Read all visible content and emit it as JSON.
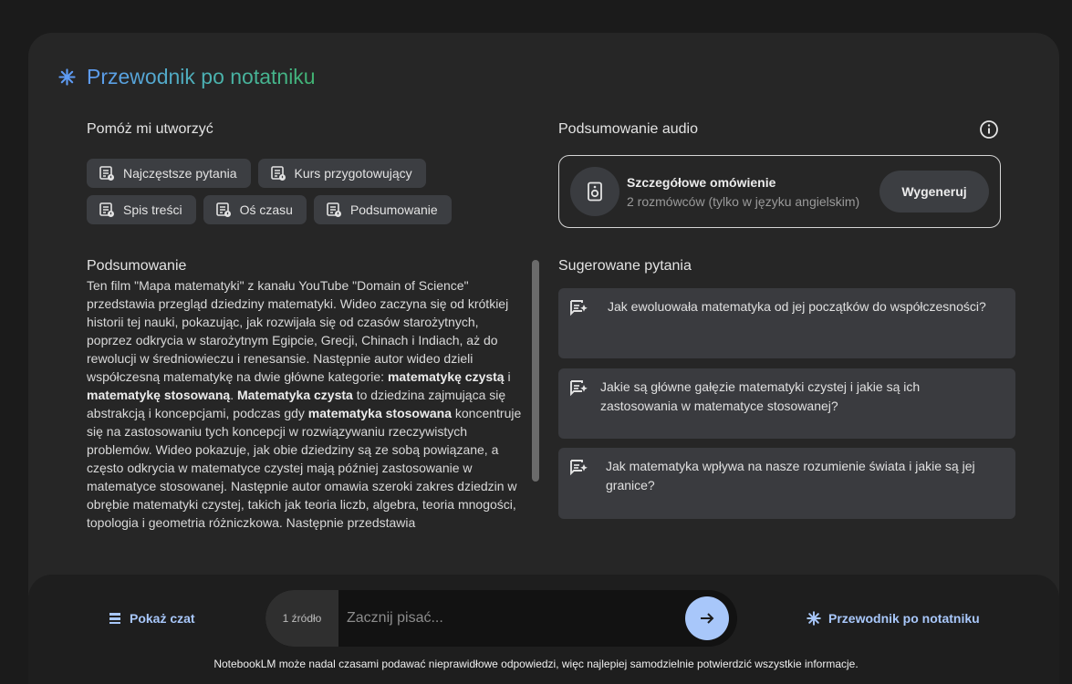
{
  "guide": {
    "title": "Przewodnik po notatniku",
    "icon": "spark-icon"
  },
  "help_create": {
    "label": "Pomóż mi utworzyć",
    "chips": [
      {
        "label": "Najczęstsze pytania",
        "icon": "note-icon"
      },
      {
        "label": "Kurs przygotowujący",
        "icon": "note-icon"
      },
      {
        "label": "Spis treści",
        "icon": "note-icon"
      },
      {
        "label": "Oś czasu",
        "icon": "note-icon"
      },
      {
        "label": "Podsumowanie",
        "icon": "note-icon"
      }
    ]
  },
  "summary": {
    "title": "Podsumowanie",
    "segments": [
      {
        "text": "Ten film \"Mapa matematyki\" z kanału YouTube \"Domain of Science\" przedstawia przegląd dziedziny matematyki. Wideo zaczyna się od krótkiej historii tej nauki, pokazując, jak rozwijała się od czasów starożytnych, poprzez odkrycia w starożytnym Egipcie, Grecji, Chinach i Indiach, aż do rewolucji w średniowieczu i renesansie. Następnie autor wideo dzieli współczesną matematykę na dwie główne kategorie: ",
        "bold": false
      },
      {
        "text": "matematykę czystą",
        "bold": true
      },
      {
        "text": " i ",
        "bold": false
      },
      {
        "text": "matematykę stosowaną",
        "bold": true
      },
      {
        "text": ". ",
        "bold": false
      },
      {
        "text": "Matematyka czysta",
        "bold": true
      },
      {
        "text": " to dziedzina zajmująca się abstrakcją i koncepcjami, podczas gdy ",
        "bold": false
      },
      {
        "text": "matematyka stosowana",
        "bold": true
      },
      {
        "text": " koncentruje się na zastosowaniu tych koncepcji w rozwiązywaniu rzeczywistych problemów. Wideo pokazuje, jak obie dziedziny są ze sobą powiązane, a często odkrycia w matematyce czystej mają później zastosowanie w matematyce stosowanej. Następnie autor omawia szeroki zakres dziedzin w obrębie matematyki czystej, takich jak teoria liczb, algebra, teoria mnogości, topologia i geometria różniczkowa. Następnie przedstawia",
        "bold": false
      }
    ]
  },
  "audio": {
    "label": "Podsumowanie audio",
    "info_icon": "info-icon",
    "card_title": "Szczegółowe omówienie",
    "card_subtitle": "2 rozmówców (tylko w języku angielskim)",
    "button": "Wygeneruj",
    "icon": "speaker-icon"
  },
  "suggested": {
    "label": "Sugerowane pytania",
    "questions": [
      {
        "text": "Jak ewoluowała matematyka od jej początków do współczesności?"
      },
      {
        "text": "Jakie są główne gałęzie matematyki czystej i jakie są ich zastosowania w matematyce stosowanej?"
      },
      {
        "text": "Jak matematyka wpływa na nasze rozumienie świata i jakie są jej granice?"
      }
    ]
  },
  "footer": {
    "show_chat": "Pokaż czat",
    "source_count": "1 źródło",
    "input_placeholder": "Zacznij pisać...",
    "guide_link": "Przewodnik po notatniku",
    "disclaimer": "NotebookLM może nadal czasami podawać nieprawidłowe odpowiedzi, więc najlepiej samodzielnie potwierdzić wszystkie informacje."
  },
  "colors": {
    "accent": "#a8c7fa",
    "panel": "#262626",
    "chip": "#3c3e42"
  }
}
